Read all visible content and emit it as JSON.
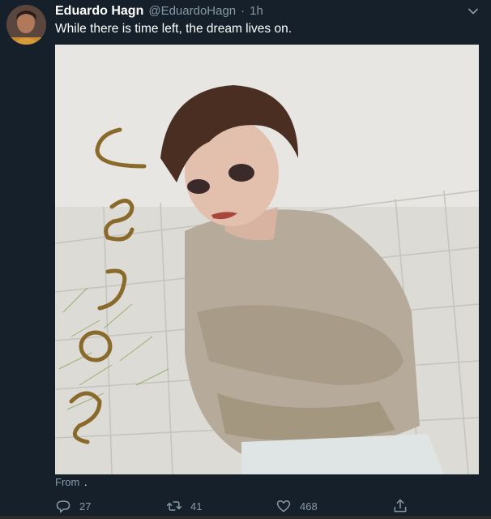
{
  "tweet": {
    "author": {
      "display_name": "Eduardo Hagn",
      "handle": "@EduardoHagn",
      "separator": "·",
      "time": "1h"
    },
    "text": "While there is time left, the dream lives on.",
    "media_caption": {
      "prefix": "From",
      "suffix": "."
    },
    "actions": {
      "reply_count": "27",
      "retweet_count": "41",
      "like_count": "468"
    },
    "icons": {
      "menu": "chevron-down-icon",
      "reply": "reply-icon",
      "retweet": "retweet-icon",
      "like": "heart-icon",
      "share": "share-icon"
    },
    "colors": {
      "background": "#15202b",
      "primary_text": "#ffffff",
      "secondary_text": "#8899a6"
    }
  }
}
